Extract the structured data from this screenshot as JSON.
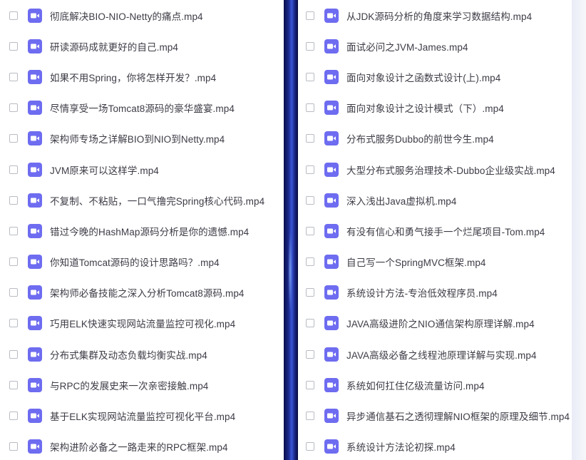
{
  "colors": {
    "icon_bg": "#6e6cf0",
    "text": "#3c3c46",
    "checkbox_border": "#b9bcc4"
  },
  "icon": "video-file-icon",
  "left_files": [
    "彻底解决BIO-NIO-Netty的痛点.mp4",
    "研读源码成就更好的自己.mp4",
    "如果不用Spring，你将怎样开发？.mp4",
    "尽情享受一场Tomcat8源码的豪华盛宴.mp4",
    "架构师专场之详解BIO到NIO到Netty.mp4",
    "JVM原来可以这样学.mp4",
    "不复制、不粘贴，一口气撸完Spring核心代码.mp4",
    "错过今晚的HashMap源码分析是你的遗憾.mp4",
    "你知道Tomcat源码的设计思路吗？.mp4",
    "架构师必备技能之深入分析Tomcat8源码.mp4",
    "巧用ELK快速实现网站流量监控可视化.mp4",
    "分布式集群及动态负载均衡实战.mp4",
    "与RPC的发展史来一次亲密接触.mp4",
    "基于ELK实现网站流量监控可视化平台.mp4",
    "架构进阶必备之一路走来的RPC框架.mp4"
  ],
  "right_files": [
    "从JDK源码分析的角度来学习数据结构.mp4",
    "面试必问之JVM-James.mp4",
    "面向对象设计之函数式设计(上).mp4",
    "面向对象设计之设计模式（下）.mp4",
    "分布式服务Dubbo的前世今生.mp4",
    "大型分布式服务治理技术-Dubbo企业级实战.mp4",
    "深入浅出Java虚拟机.mp4",
    "有没有信心和勇气接手一个烂尾项目-Tom.mp4",
    "自己写一个SpringMVC框架.mp4",
    "系统设计方法-专治低效程序员.mp4",
    "JAVA高级进阶之NIO通信架构原理详解.mp4",
    "JAVA高级必备之线程池原理详解与实现.mp4",
    "系统如何扛住亿级流量访问.mp4",
    "异步通信基石之透彻理解NIO框架的原理及细节.mp4",
    "系统设计方法论初探.mp4"
  ]
}
